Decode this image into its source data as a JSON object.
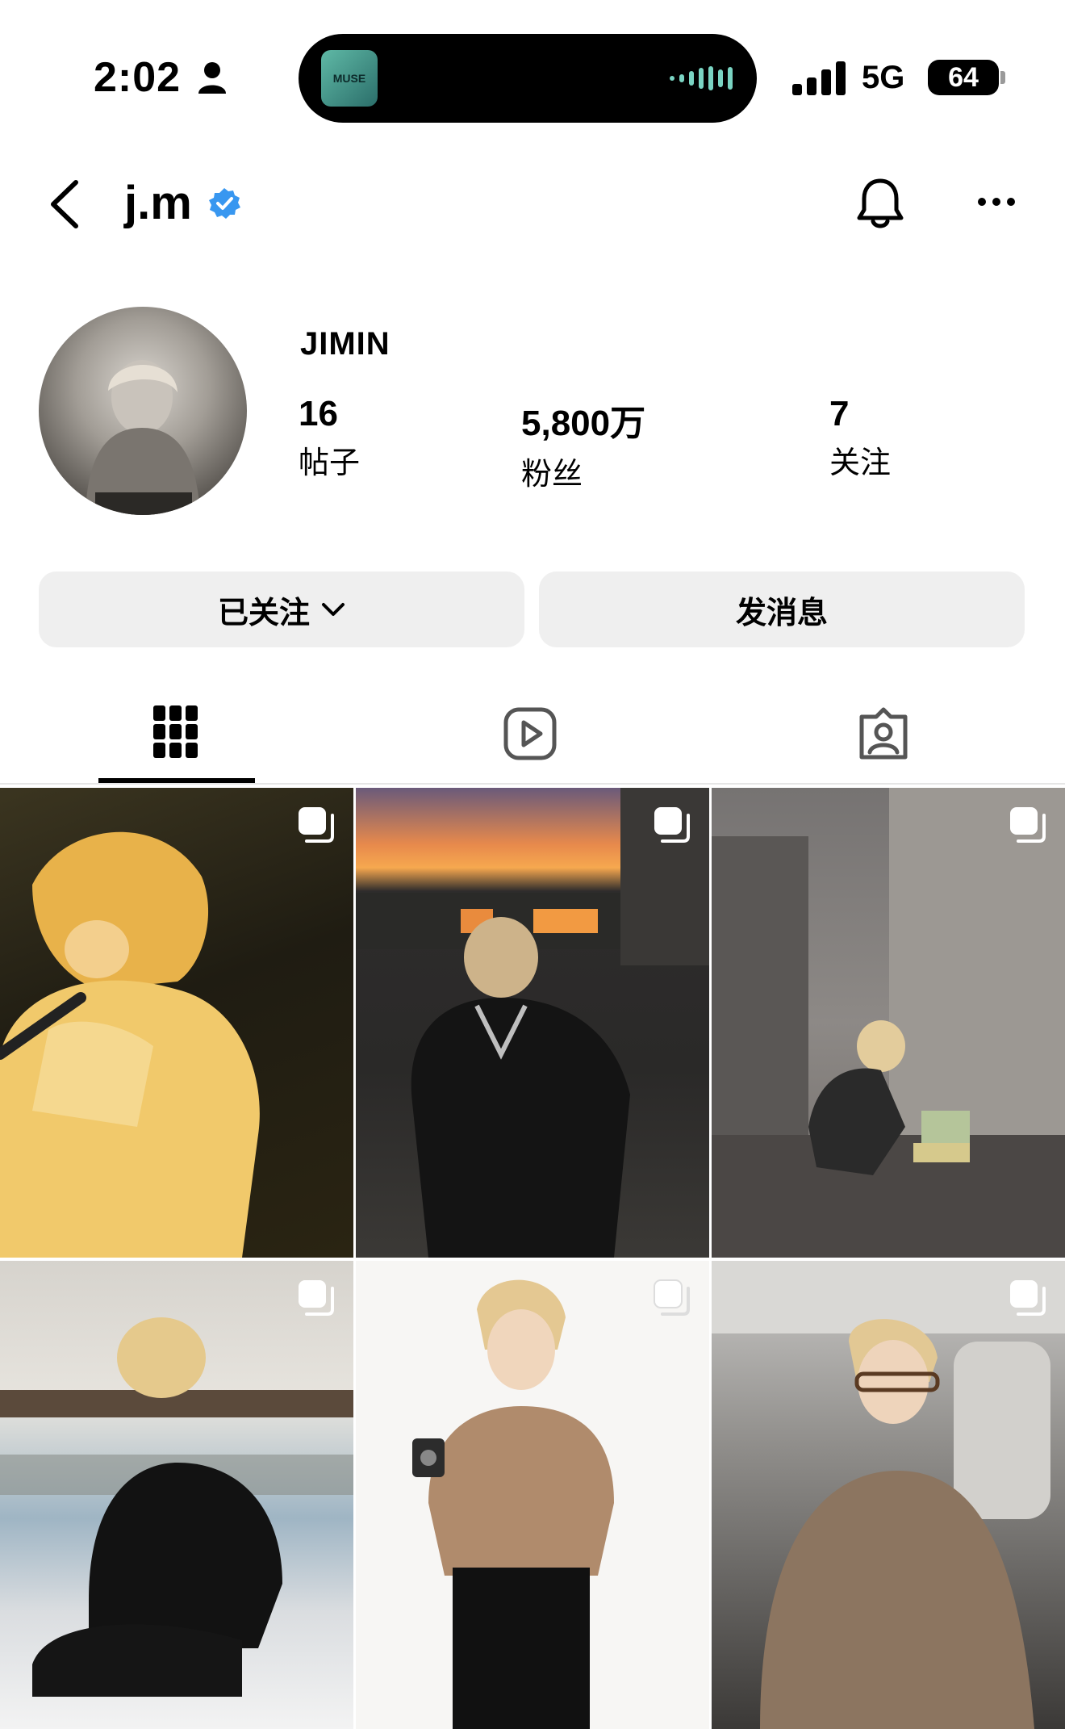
{
  "status_bar": {
    "time": "2:02",
    "network": "5G",
    "battery": "64",
    "island_art_text": "MUSE"
  },
  "header": {
    "username": "j.m"
  },
  "profile": {
    "display_name": "JIMIN",
    "stats": [
      {
        "value": "16",
        "label": "帖子"
      },
      {
        "value": "5,800万",
        "label": "粉丝"
      },
      {
        "value": "7",
        "label": "关注"
      }
    ]
  },
  "actions": {
    "following_label": "已关注",
    "message_label": "发消息"
  },
  "tabs": [
    {
      "icon": "grid-icon",
      "active": true
    },
    {
      "icon": "reels-icon",
      "active": false
    },
    {
      "icon": "tagged-icon",
      "active": false
    }
  ],
  "posts": [
    {
      "subject": "singer-with-microphone",
      "multi": true
    },
    {
      "subject": "night-rooftop-portrait",
      "multi": true
    },
    {
      "subject": "industrial-room-crouching",
      "multi": true
    },
    {
      "subject": "sailboat-deck-sitting",
      "multi": true
    },
    {
      "subject": "studio-camera-pose",
      "multi": true
    },
    {
      "subject": "car-selfie-glasses",
      "multi": true
    }
  ],
  "colors": {
    "verified": "#3897f0",
    "button_bg": "#efefef",
    "text": "#000000"
  }
}
